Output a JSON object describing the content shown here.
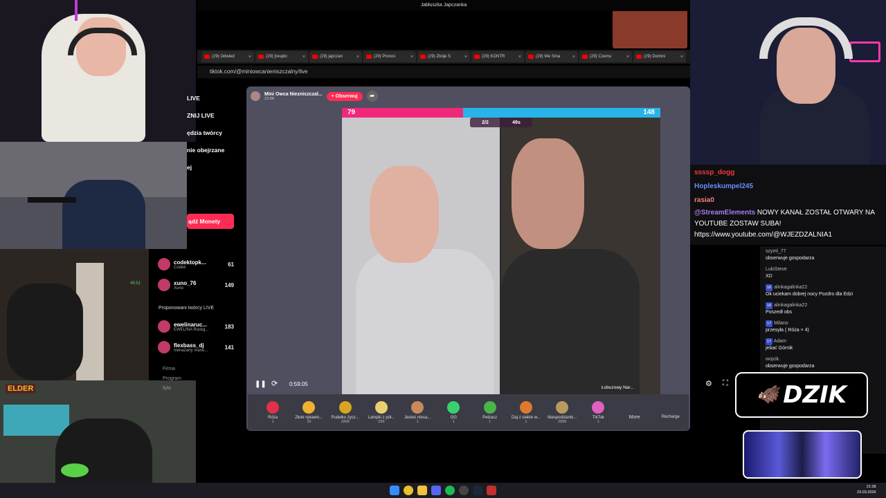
{
  "window_title": "Jabłuszka Japczanka",
  "browser": {
    "tabs": [
      {
        "label": "(29) Odwied"
      },
      {
        "label": "(29) [reuplo"
      },
      {
        "label": "(29) japczan"
      },
      {
        "label": "(29) Pronos"
      },
      {
        "label": "(29) Zbóje S"
      },
      {
        "label": "(29) KONTR"
      },
      {
        "label": "(29) We Sma"
      },
      {
        "label": "(29) Czemu"
      },
      {
        "label": "(29) Domini"
      }
    ],
    "url": "tiktok.com/@miniowcanieniszczalny/live"
  },
  "tiktok": {
    "nav": [
      "LIVE",
      "ZNIJ LIVE",
      "ędzia twórcy",
      "nie obejrzane",
      "ej"
    ],
    "coins_button": "ądź Monety",
    "creators": [
      {
        "name": "codektopk...",
        "sub": "Codek",
        "count": "61"
      },
      {
        "name": "xuno_76",
        "sub": "Xuno",
        "count": "149"
      }
    ],
    "suggested_title": "Proponowani twórcy LIVE",
    "suggested": [
      {
        "name": "ewelinaruc...",
        "sub": "EWELINA Ruckg...",
        "count": "183"
      },
      {
        "name": "flexbass_dj",
        "sub": "nienażarty mariu...",
        "count": "141"
      }
    ],
    "footer": [
      "Firma",
      "Program",
      "ltyki"
    ],
    "host": {
      "name": "Mini Owca Niezniszczal...",
      "likes": "23.8K",
      "follow": "+ Obserwuj"
    },
    "battle": {
      "score_left": "79",
      "score_right": "148",
      "participants": "2/2",
      "timer": "49s",
      "right_name": "Łobuzowy",
      "right_name2": "Nar..."
    },
    "playback_time": "0:59:05",
    "gifts": [
      {
        "name": "Róża",
        "price": "1",
        "color": "#e0304a"
      },
      {
        "name": "Złote rękawic...",
        "price": "10",
        "color": "#f0b030"
      },
      {
        "name": "Pudełko życz...",
        "price": "1999",
        "color": "#d9a520"
      },
      {
        "name": "Lampki z pół...",
        "price": "299",
        "color": "#e8d070"
      },
      {
        "name": "Jesteś niesa...",
        "price": "1",
        "color": "#c88a5a"
      },
      {
        "name": "GG",
        "price": "1",
        "color": "#3ad070"
      },
      {
        "name": "Pełzacz",
        "price": "1",
        "color": "#4ab44a"
      },
      {
        "name": "Daj z siebie w...",
        "price": "1",
        "color": "#e07830"
      },
      {
        "name": "Niespodzianki...",
        "price": "2999",
        "color": "#b89a60"
      },
      {
        "name": "TikTok",
        "price": "1",
        "color": "#e060c0"
      }
    ],
    "more": "More",
    "recharge": "Recharge"
  },
  "stream_overlay": {
    "line1_user": "ssssp_dogg",
    "line2_user": "Hopleskumpel245",
    "line3_user": "rasia0",
    "alert_user": "@StreamElements",
    "alert_text": "NOWY KANAŁ ZOSTAŁ OTWARY NA YOUTUBE ZOSTAW SUBA!",
    "alert_link": "https://www.youtube.com/@WJEZDZALNIA1"
  },
  "chat": [
    {
      "user": "szyml_77",
      "text": "obserwuje gospodarza"
    },
    {
      "user": "LukiSteve",
      "text": "XD"
    },
    {
      "user": "alinkagalinka22",
      "badge": "16",
      "text": "Ok uciekam dobrej nocy Pozdro dla Edzi"
    },
    {
      "user": "alinkagalinka22",
      "badge": "16",
      "text": "Poszedł obs"
    },
    {
      "user": "Milano",
      "badge": "17",
      "text": "przesyła ( Róża × 4)"
    },
    {
      "user": "Adam",
      "badge": "17",
      "text": "jebać Górnik"
    },
    {
      "user": "wojcik.",
      "text": "obserwuje gospodarza"
    }
  ],
  "brand": "DZIK",
  "cam_labels": {
    "elder": "ELDER",
    "timer": "45:51"
  },
  "clock": {
    "time": "21:38",
    "date": "23.03.2026"
  }
}
